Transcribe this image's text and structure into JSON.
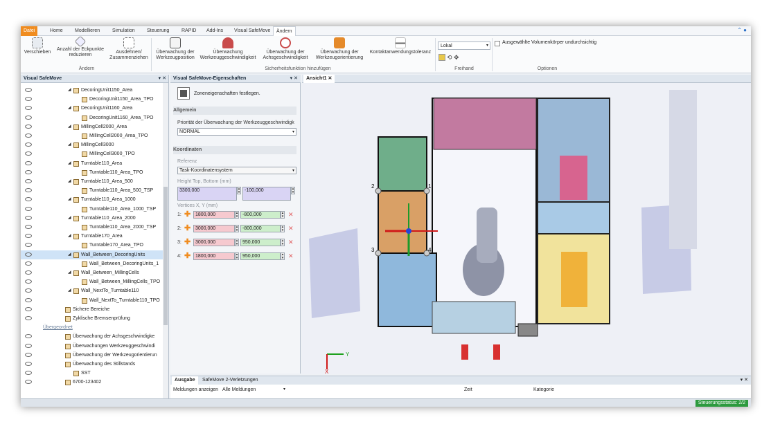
{
  "tabs": [
    "Datei",
    "Home",
    "Modellieren",
    "Simulation",
    "Steuerung",
    "RAPID",
    "Add-Ins",
    "Visual SafeMove",
    "Ändern"
  ],
  "ribbon": {
    "verschieben": "Verschieben",
    "anzahl": "Anzahl der Eckpunkte reduzieren",
    "ausdehnen": "Ausdehnen/ Zusammenziehen",
    "group_aendern": "Ändern",
    "ue_werkzeugpos": "Überwachung der Werkzeugposition",
    "ue_werkzeuggeschw": "Überwachung Werkzeuggeschwindigkeit",
    "ue_achsgeschw": "Überwachung der Achsgeschwindigkeit",
    "ue_werkzeugorient": "Überwachung der Werkzeugorientierung",
    "kontakt": "Kontaktanwendungstoleranz",
    "group_sicherheit": "Sicherheitsfunktion hinzufügen",
    "lokal": "Lokal",
    "group_freihand": "Freihand",
    "undurchsichtig": "Ausgewählte Volumenkörper undurchsichtig",
    "group_optionen": "Optionen"
  },
  "left": {
    "title": "Visual SafeMove",
    "items": [
      {
        "label": "DecoringUnit1150_Area",
        "lvl": 1
      },
      {
        "label": "DecoringUnit1150_Area_TPO",
        "lvl": 2
      },
      {
        "label": "DecoringUnit1160_Area",
        "lvl": 1
      },
      {
        "label": "DecoringUnit1160_Area_TPO",
        "lvl": 2
      },
      {
        "label": "MillingCell2000_Area",
        "lvl": 1
      },
      {
        "label": "MillingCell2000_Area_TPO",
        "lvl": 2
      },
      {
        "label": "MillingCell3000",
        "lvl": 1
      },
      {
        "label": "MillingCell3000_TPO",
        "lvl": 2
      },
      {
        "label": "Turntable110_Area",
        "lvl": 1
      },
      {
        "label": "Turntable110_Area_TPO",
        "lvl": 2
      },
      {
        "label": "Turntable110_Area_500",
        "lvl": 1
      },
      {
        "label": "Turntable110_Area_500_TSP",
        "lvl": 2
      },
      {
        "label": "Turntable110_Area_1000",
        "lvl": 1
      },
      {
        "label": "Turntable110_Area_1000_TSP",
        "lvl": 2
      },
      {
        "label": "Turntable110_Area_2000",
        "lvl": 1
      },
      {
        "label": "Turntable110_Area_2000_TSP",
        "lvl": 2
      },
      {
        "label": "Turntable170_Area",
        "lvl": 1
      },
      {
        "label": "Turntable170_Area_TPO",
        "lvl": 2
      },
      {
        "label": "Wall_Between_DecoringUnits",
        "lvl": 1
      },
      {
        "label": "Wall_Between_DecoringUnits_1",
        "lvl": 2
      },
      {
        "label": "Wall_Between_MillingCells",
        "lvl": 1
      },
      {
        "label": "Wall_Between_MillingCells_TPO",
        "lvl": 2
      },
      {
        "label": "Wall_NextTo_Turntable110",
        "lvl": 1
      },
      {
        "label": "Wall_NextTo_Turntable110_TPO",
        "lvl": 2
      },
      {
        "label": "Sichere Bereiche",
        "lvl": 0
      },
      {
        "label": "Zyklische Bremsenprüfung",
        "lvl": 0
      },
      {
        "label": "Übergeordnet",
        "lvl": -1
      },
      {
        "label": "Überwachung der Achsgeschwindigke",
        "lvl": 0
      },
      {
        "label": "Überwachungen Werkzeuggeschwindi",
        "lvl": 0
      },
      {
        "label": "Überwachung der Werkzeugorientierun",
        "lvl": 0
      },
      {
        "label": "Überwachung des Stillstands",
        "lvl": 0
      },
      {
        "label": "SST",
        "lvl": 1
      },
      {
        "label": "6700-123402",
        "lvl": 0
      }
    ]
  },
  "props": {
    "title": "Visual SafeMove-Eigenschaften",
    "zone_text": "Zoneneigenschaften festlegen.",
    "allgemein": "Allgemein",
    "prio_label": "Priorität der Überwachung der Werkzeuggeschwindigk",
    "prio_value": "NORMAL",
    "koordinaten": "Koordinaten",
    "referenz_label": "Referenz",
    "referenz_value": "Task-Koordinatensystem",
    "height_label": "Height Top, Bottom (mm)",
    "height_top": "3300,000",
    "height_bottom": "-100,000",
    "vertices_label": "Vertices X, Y (mm)",
    "vertices": [
      {
        "n": "1:",
        "x": "1800,000",
        "y": "-800,000"
      },
      {
        "n": "2:",
        "x": "3000,000",
        "y": "-800,000"
      },
      {
        "n": "3:",
        "x": "3000,000",
        "y": "950,000"
      },
      {
        "n": "4:",
        "x": "1800,000",
        "y": "950,000"
      }
    ]
  },
  "view": {
    "tab": "Ansicht1",
    "axis_x": "X",
    "axis_y": "Y",
    "c1": "1",
    "c2": "2",
    "c3": "3",
    "c4": "4"
  },
  "output": {
    "tab1": "Ausgabe",
    "tab2": "SafeMove 2-Verletzungen",
    "show_label": "Meldungen anzeigen",
    "show_value": "Alle Meldungen",
    "col_zeit": "Zeit",
    "col_kategorie": "Kategorie"
  },
  "status": "Steuerungsstatus: 2/2"
}
